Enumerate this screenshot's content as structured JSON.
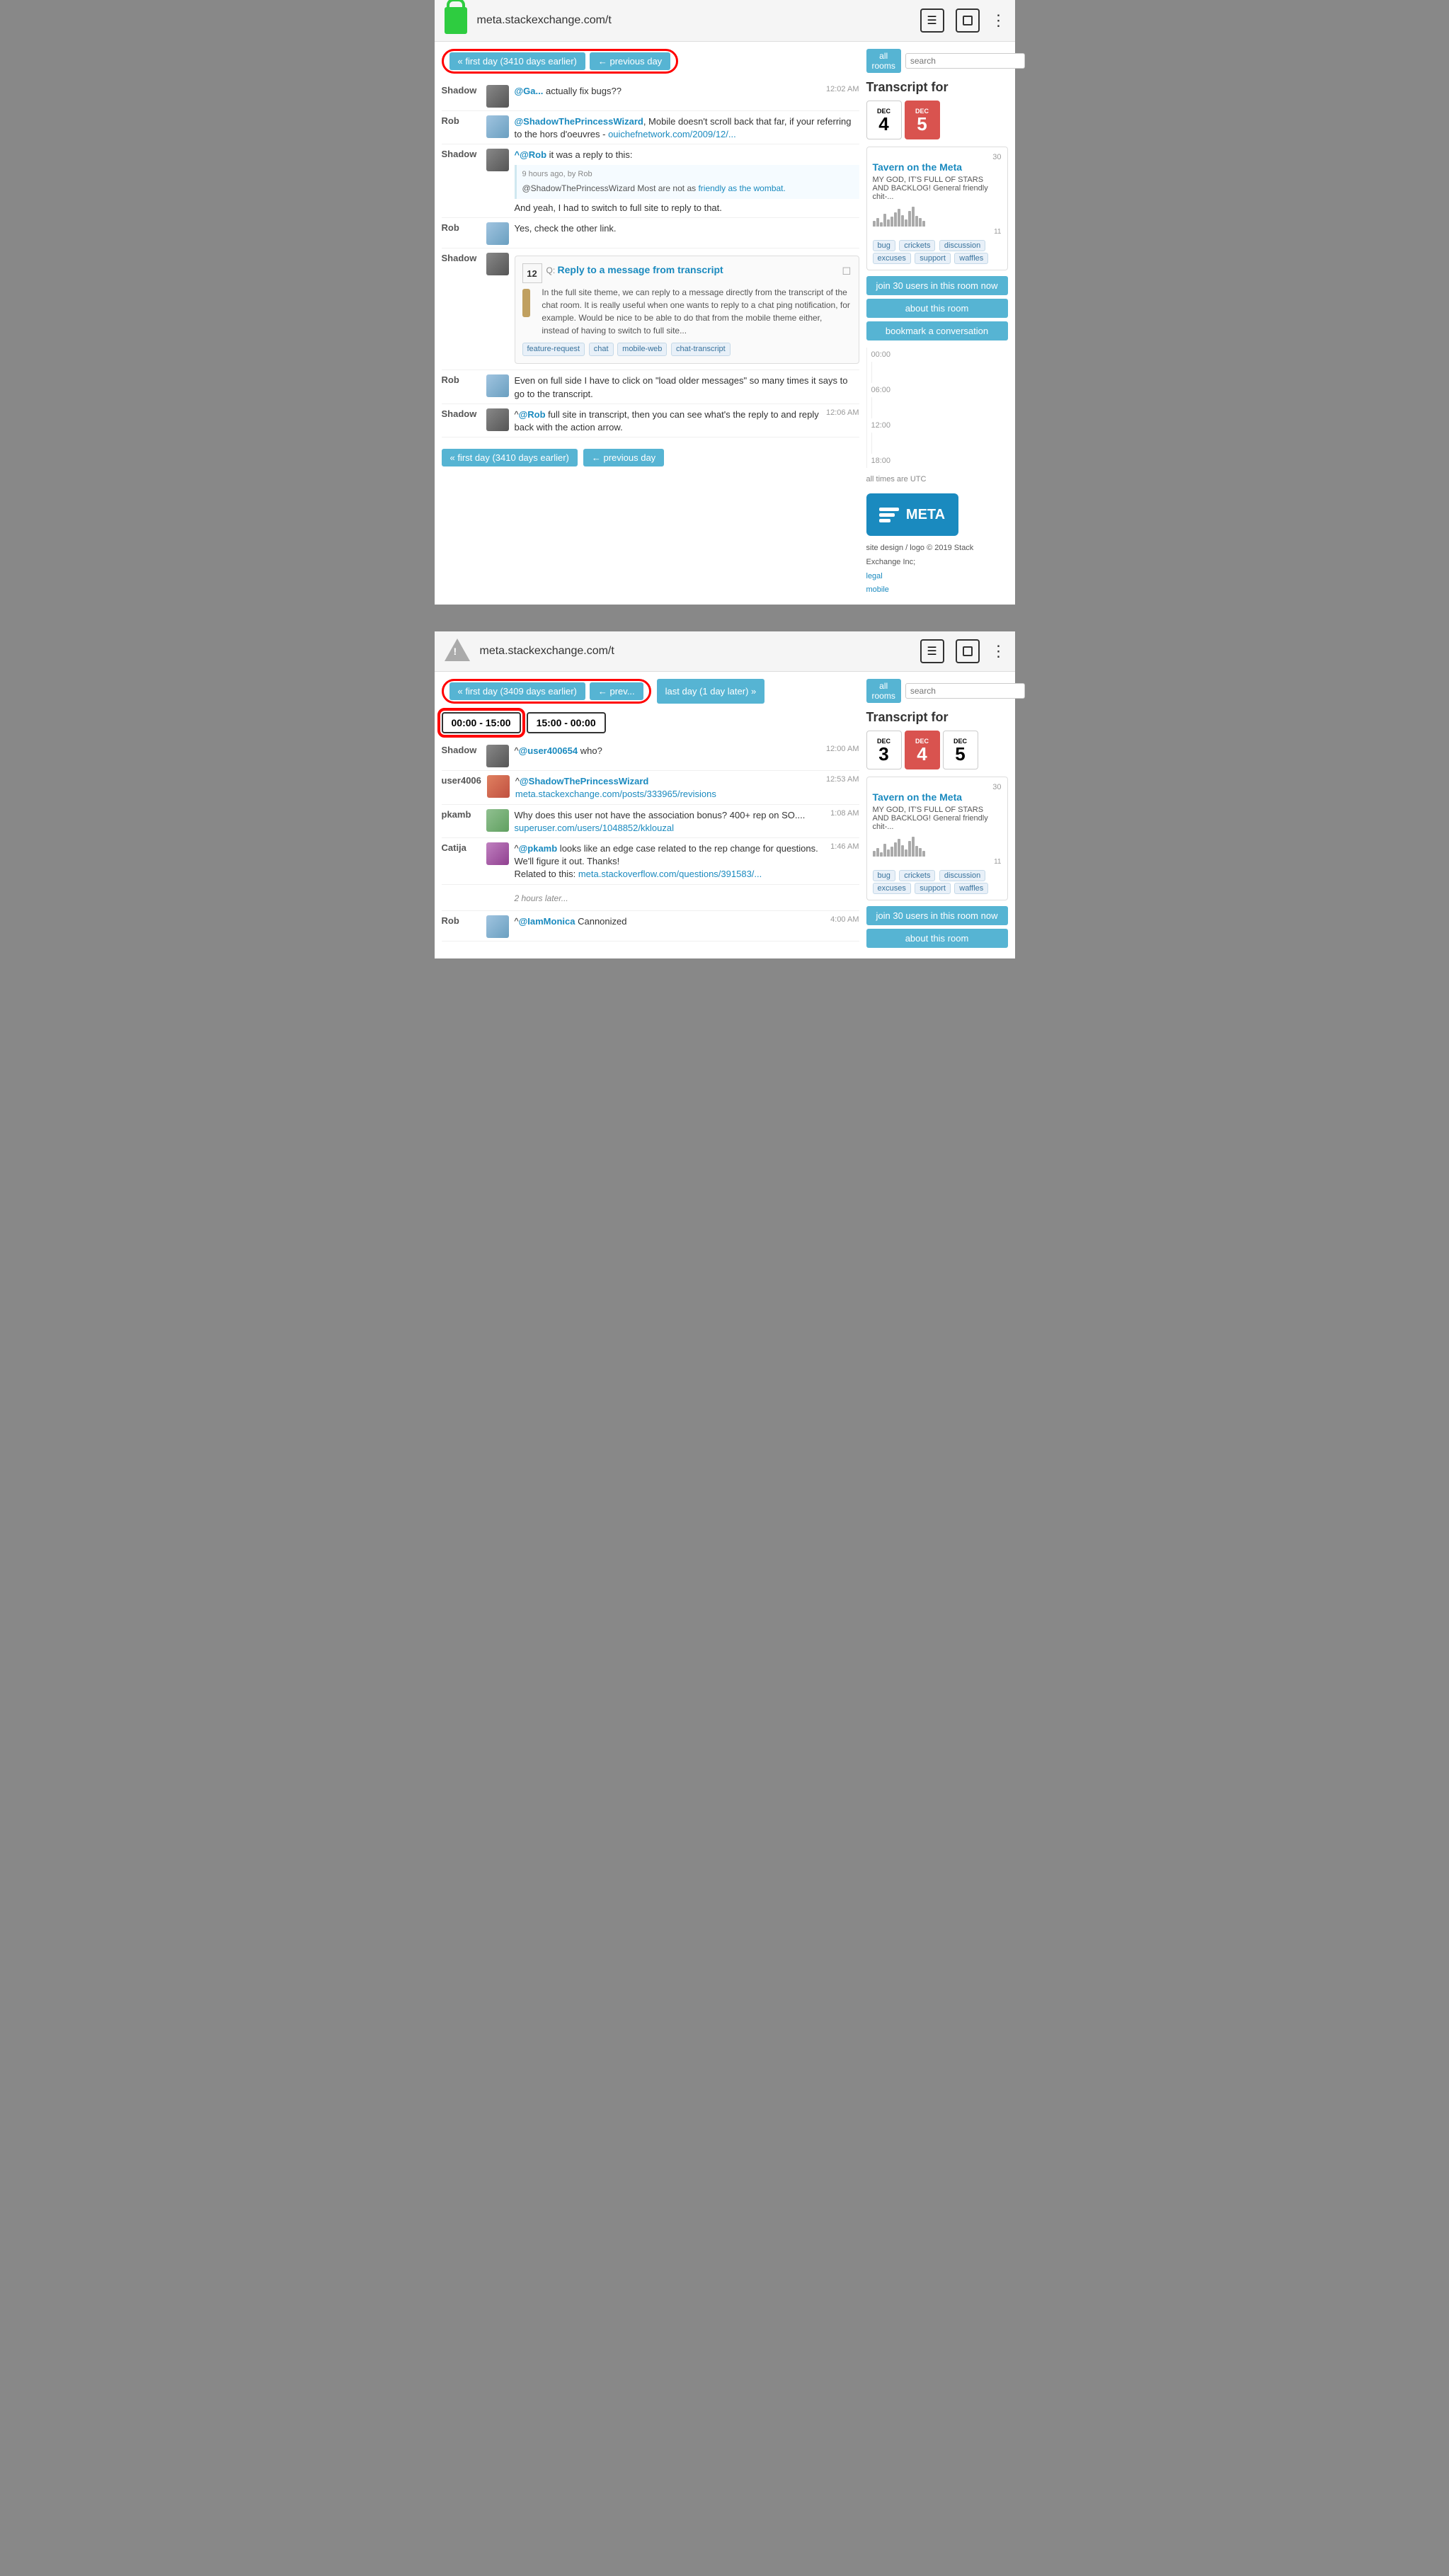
{
  "screen1": {
    "browser": {
      "url": "meta.stackexchange.com/t",
      "lock": "green",
      "icon_lines": "☰",
      "icon_reader": "reader",
      "icon_dots": "⋮"
    },
    "nav": {
      "first_day": "« first day (3410 days earlier)",
      "prev_day": "← previous day"
    },
    "messages": [
      {
        "user": "Shadow",
        "avatar": "shadow",
        "text": "@Ga... actually fix bugs??",
        "time": "12:02 AM"
      },
      {
        "user": "Rob",
        "avatar": "rob",
        "text": "@ShadowThePrincessWizard, Mobile doesn't scroll back that far, if your referring to the hors d'oeuvres - ouichefnetwork.com/2009/12/...",
        "time": ""
      },
      {
        "user": "Shadow",
        "avatar": "shadow",
        "at": "@Rob",
        "text": "it was a reply to this:",
        "reply_meta": "9 hours ago, by Rob",
        "reply_text": "@ShadowThePrincessWizard Most are not as friendly as the wombat.",
        "after": "And yeah, I had to switch to full site to reply to that.",
        "time": ""
      },
      {
        "user": "Rob",
        "avatar": "rob",
        "text": "Yes, check the other link.",
        "time": ""
      },
      {
        "user": "Shadow",
        "avatar": "shadow",
        "question": true,
        "q_score": "12",
        "q_label": "Q:",
        "q_title": "Reply to a message from transcript",
        "q_body": "In the full site theme, we can reply to a message directly from the transcript of the chat room. It is really useful when one wants to reply to a chat ping notification, for example. Would be nice to be able to do that from the mobile theme either, instead of having to switch to full site...",
        "q_tags": [
          "feature-request",
          "chat",
          "mobile-web",
          "chat-transcript"
        ],
        "time": ""
      },
      {
        "user": "Rob",
        "avatar": "rob",
        "text": "Even on full side I have to click on \"load older messages\" so many times it says to go to the transcript.",
        "time": ""
      },
      {
        "user": "Shadow",
        "avatar": "shadow",
        "at": "@Rob",
        "text": "full site in transcript, then you can see what's the reply to and reply back with the action arrow.",
        "time": "12:06 AM"
      }
    ],
    "nav_bottom": {
      "first_day": "« first day (3410 days earlier)",
      "prev_day": "← previous day"
    },
    "sidebar": {
      "all_rooms": "all rooms",
      "search_placeholder": "search",
      "transcript_title": "Transcript for",
      "cal_days": [
        {
          "month": "Dec",
          "num": "4",
          "active": false
        },
        {
          "month": "Dec",
          "num": "5",
          "active": true
        }
      ],
      "room_name": "Tavern on the Meta",
      "room_desc": "MY GOD, IT'S FULL OF STARS AND BACKLOG! General friendly chit-...",
      "room_count_top": "30",
      "room_count_bottom": "11",
      "room_tags": [
        "bug",
        "crickets",
        "discussion",
        "excuses",
        "support",
        "waffles"
      ],
      "join_btn": "join 30 users in this room now",
      "about_btn": "about this room",
      "bookmark_btn": "bookmark a conversation",
      "timeline_labels": [
        "00:00",
        "06:00",
        "12:00",
        "18:00"
      ],
      "timezone": "all times are UTC"
    },
    "footer": {
      "site_design": "site design / logo © 2019 Stack Exchange Inc;",
      "legal": "legal",
      "mobile": "mobile"
    }
  },
  "screen2": {
    "browser": {
      "url": "meta.stackexchange.com/t",
      "lock": "gray",
      "icon_dots": "⋮"
    },
    "nav": {
      "first_day": "first day (3409 days earlier)",
      "prev_day": "← prev...",
      "last_day": "last day (1 day later) »"
    },
    "time_filters": [
      {
        "label": "00:00 - 15:00",
        "active": true
      },
      {
        "label": "15:00 - 00:00",
        "active": false
      }
    ],
    "messages": [
      {
        "user": "Shadow",
        "avatar": "shadow",
        "text": "@user400654 who?",
        "time": "12:00 AM"
      },
      {
        "user": "user4006",
        "avatar": "user4006",
        "at": "@ShadowThePrincessWizard",
        "text": "meta.stackexchange.com/posts/333965/revisions",
        "time": "12:53 AM"
      },
      {
        "user": "pkamb",
        "avatar": "pkamb",
        "text": "Why does this user not have the association bonus? 400+ rep on SO.... superuser.com/users/1048852/kklouzal",
        "time": "1:08 AM"
      },
      {
        "user": "Catija",
        "avatar": "catija",
        "at": "@pkamb",
        "text": "looks like an edge case related to the rep change for questions. We'll figure it out. Thanks! Related to this: meta.stackoverflow.com/questions/391583/...",
        "time": "1:46 AM"
      },
      {
        "user": "",
        "two_hours": "2 hours later..."
      },
      {
        "user": "Rob",
        "avatar": "rob",
        "at": "@IamMonica",
        "text": "Cannonized",
        "time": "4:00 AM"
      }
    ],
    "sidebar": {
      "all_rooms": "all rooms",
      "search_placeholder": "search",
      "transcript_title": "Transcript for",
      "cal_days": [
        {
          "month": "Dec",
          "num": "3",
          "active": false
        },
        {
          "month": "Dec",
          "num": "4",
          "active": true
        },
        {
          "month": "Dec",
          "num": "5",
          "active": false
        }
      ],
      "room_name": "Tavern on the Meta",
      "room_desc": "MY GOD, IT'S FULL OF STARS AND BACKLOG! General friendly chit-...",
      "room_count_top": "30",
      "room_count_bottom": "11",
      "room_tags": [
        "bug",
        "crickets",
        "discussion",
        "excuses",
        "support",
        "waffles"
      ],
      "join_btn": "join 30 users in this room now",
      "about_btn": "about this room",
      "crickets_label": "crickets"
    }
  }
}
